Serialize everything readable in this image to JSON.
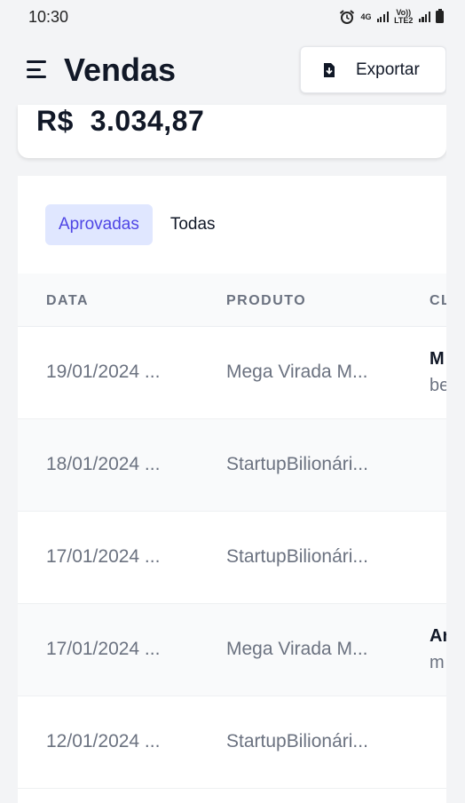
{
  "status_bar": {
    "time": "10:30",
    "network_label_top": "4G",
    "network_label_bottom": "Vo)) LTE2"
  },
  "header": {
    "menu_icon": "menu-icon",
    "title": "Vendas",
    "export_label": "Exportar",
    "export_icon": "file-download-icon"
  },
  "summary": {
    "total_value": "R$  3.034,87"
  },
  "tabs": [
    {
      "label": "Aprovadas",
      "active": true
    },
    {
      "label": "Todas",
      "active": false
    }
  ],
  "table": {
    "columns": [
      "DATA",
      "PRODUTO",
      "CL"
    ],
    "rows": [
      {
        "date": "19/01/2024 ...",
        "product": "Mega Virada M...",
        "client_name": "M",
        "client_email": "be"
      },
      {
        "date": "18/01/2024 ...",
        "product": "StartupBilionári...",
        "client_name": "",
        "client_email": ""
      },
      {
        "date": "17/01/2024 ...",
        "product": "StartupBilionári...",
        "client_name": "",
        "client_email": ""
      },
      {
        "date": "17/01/2024 ...",
        "product": "Mega Virada M...",
        "client_name": "Ar",
        "client_email": "m"
      },
      {
        "date": "12/01/2024 ...",
        "product": "StartupBilionári...",
        "client_name": "",
        "client_email": ""
      }
    ]
  },
  "colors": {
    "accent": "#4f46e5",
    "accent_bg": "#e0e7ff",
    "page_bg": "#f3f4f6"
  }
}
